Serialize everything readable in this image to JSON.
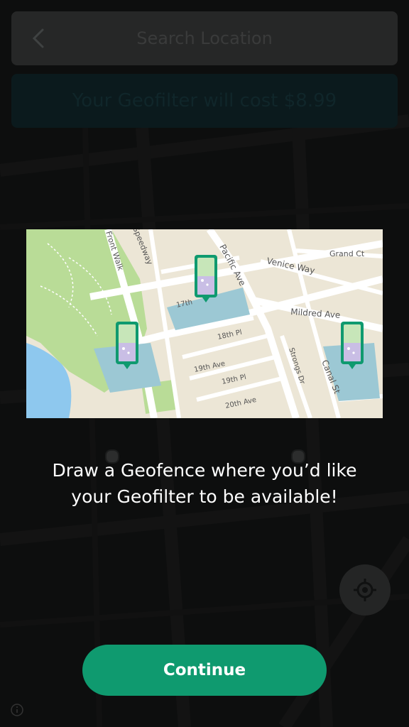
{
  "header": {
    "back_icon": "chevron-left-icon",
    "search_placeholder": "Search Location"
  },
  "cost_banner": {
    "text": "Your Geofilter will cost $8.99"
  },
  "map_preview": {
    "streets": {
      "front_walk": "Front Walk",
      "speedway": "Speedway",
      "pacific_ave": "Pacific Ave",
      "grand_ct": "Grand Ct",
      "venice_way": "Venice Way",
      "mildred_ave": "Mildred Ave",
      "seventeenth": "17th",
      "eighteenth_pl": "18th Pl",
      "nineteenth_ave": "19th Ave",
      "nineteenth_pl": "19th Pl",
      "twentieth_ave": "20th Ave",
      "strongs_dr": "Strongs Dr",
      "canal_st": "Canal St"
    },
    "colors": {
      "land": "#ece6d6",
      "park": "#b9dc97",
      "water": "#8ec8ee",
      "fence": "#9cc8d4",
      "pin": "#0f9a6f"
    }
  },
  "message": {
    "line1": "Draw a Geofence where you’d like",
    "line2": "your Geofilter to be available!"
  },
  "continue_button": {
    "label": "Continue"
  },
  "icons": {
    "locate": "crosshair-icon",
    "info": "info-icon"
  }
}
